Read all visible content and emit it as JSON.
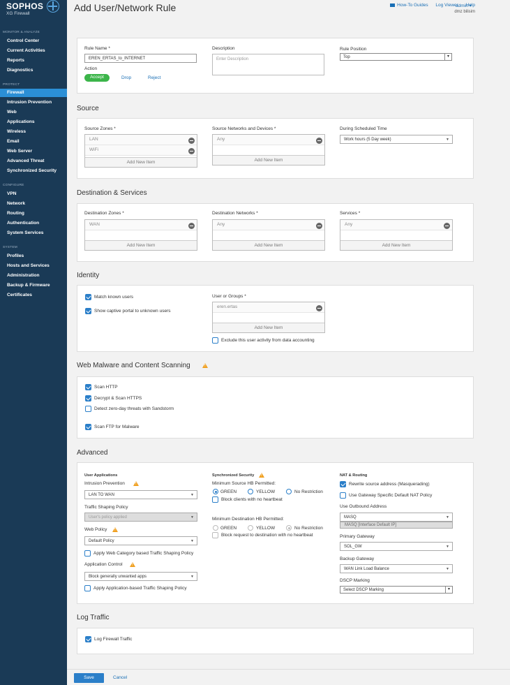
{
  "brand": {
    "name": "SOPHOS",
    "product": "XG Firewall"
  },
  "nav": {
    "sections": [
      {
        "label": "MONITOR & ANALYZE",
        "items": [
          "Control Center",
          "Current Activities",
          "Reports",
          "Diagnostics"
        ]
      },
      {
        "label": "PROTECT",
        "items": [
          "Firewall",
          "Intrusion Prevention",
          "Web",
          "Applications",
          "Wireless",
          "Email",
          "Web Server",
          "Advanced Threat",
          "Synchronized Security"
        ]
      },
      {
        "label": "CONFIGURE",
        "items": [
          "VPN",
          "Network",
          "Routing",
          "Authentication",
          "System Services"
        ]
      },
      {
        "label": "SYSTEM",
        "items": [
          "Profiles",
          "Hosts and Services",
          "Administration",
          "Backup & Firmware",
          "Certificates"
        ]
      }
    ],
    "active": "Firewall"
  },
  "header": {
    "title": "Add User/Network Rule",
    "links": {
      "howto": "How-To Guides",
      "logviewer": "Log Viewer",
      "help": "Help"
    },
    "user": "admin ▾",
    "device": "dmz bilisim"
  },
  "rule": {
    "name_label": "Rule Name *",
    "name_value": "EREN_ERTAS_to_INTERNET",
    "action_label": "Action",
    "actions": {
      "accept": "Accept",
      "drop": "Drop",
      "reject": "Reject"
    },
    "description_label": "Description",
    "description_placeholder": "Enter Description",
    "position_label": "Rule Position",
    "position_value": "Top"
  },
  "source": {
    "title": "Source",
    "zones_label": "Source Zones *",
    "zones": [
      "LAN",
      "WiFi"
    ],
    "networks_label": "Source Networks and Devices *",
    "networks": [
      "Any"
    ],
    "schedule_label": "During Scheduled Time",
    "schedule_value": "Work hours (5 Day week)",
    "add_new": "Add New Item"
  },
  "destination": {
    "title": "Destination & Services",
    "zones_label": "Destination Zones *",
    "zones": [
      "WAN"
    ],
    "networks_label": "Destination Networks *",
    "networks": [
      "Any"
    ],
    "services_label": "Services *",
    "services": [
      "Any"
    ],
    "add_new": "Add New Item"
  },
  "identity": {
    "title": "Identity",
    "match_known": "Match known users",
    "captive_portal": "Show captive portal to unknown users",
    "users_label": "User or Groups *",
    "users": [
      "eren.ertas"
    ],
    "add_new": "Add New Item",
    "exclude": "Exclude this user activity from data accounting"
  },
  "malware": {
    "title": "Web Malware and Content Scanning",
    "scan_http": "Scan HTTP",
    "decrypt_https": "Decrypt & Scan HTTPS",
    "zero_day": "Detect zero-day threats with Sandstorm",
    "scan_ftp": "Scan FTP for Malware"
  },
  "advanced": {
    "title": "Advanced",
    "user_apps": {
      "heading": "User Applications",
      "ips_label": "Intrusion Prevention",
      "ips_value": "LAN TO WAN",
      "shaping_label": "Traffic Shaping Policy",
      "shaping_value": "User's policy applied",
      "web_label": "Web Policy",
      "web_value": "Default Policy",
      "web_shaping": "Apply Web Category based Traffic Shaping Policy",
      "app_label": "Application Control",
      "app_value": "Block generally unwanted apps",
      "app_shaping": "Apply Application-based Traffic Shaping Policy"
    },
    "sync": {
      "heading": "Synchronized Security",
      "min_src_label": "Minimum Source HB Permitted:",
      "min_dst_label": "Minimum Destination HB Permitted:",
      "green": "GREEN",
      "yellow": "YELLOW",
      "norestriction": "No Restriction",
      "block_src": "Block clients with no heartbeat",
      "block_dst": "Block request to destination with no heartbeat"
    },
    "nat": {
      "heading": "NAT & Routing",
      "masquerade": "Rewrite source address (Masquerading)",
      "gateway_nat": "Use Gateway Specific Default NAT Policy",
      "outbound_label": "Use Outbound Address",
      "outbound_value": "MASQ",
      "outbound_option": "MASQ [Interface Default IP]",
      "primary_gw_label": "Primary Gateway",
      "primary_gw_value": "SOL_GW",
      "backup_gw_label": "Backup Gateway",
      "backup_gw_value": "WAN Link Load Balance",
      "dscp_label": "DSCP Marking",
      "dscp_value": "Select DSCP Marking"
    }
  },
  "log": {
    "title": "Log Traffic",
    "log_firewall": "Log Firewall Traffic"
  },
  "footer": {
    "save": "Save",
    "cancel": "Cancel"
  }
}
